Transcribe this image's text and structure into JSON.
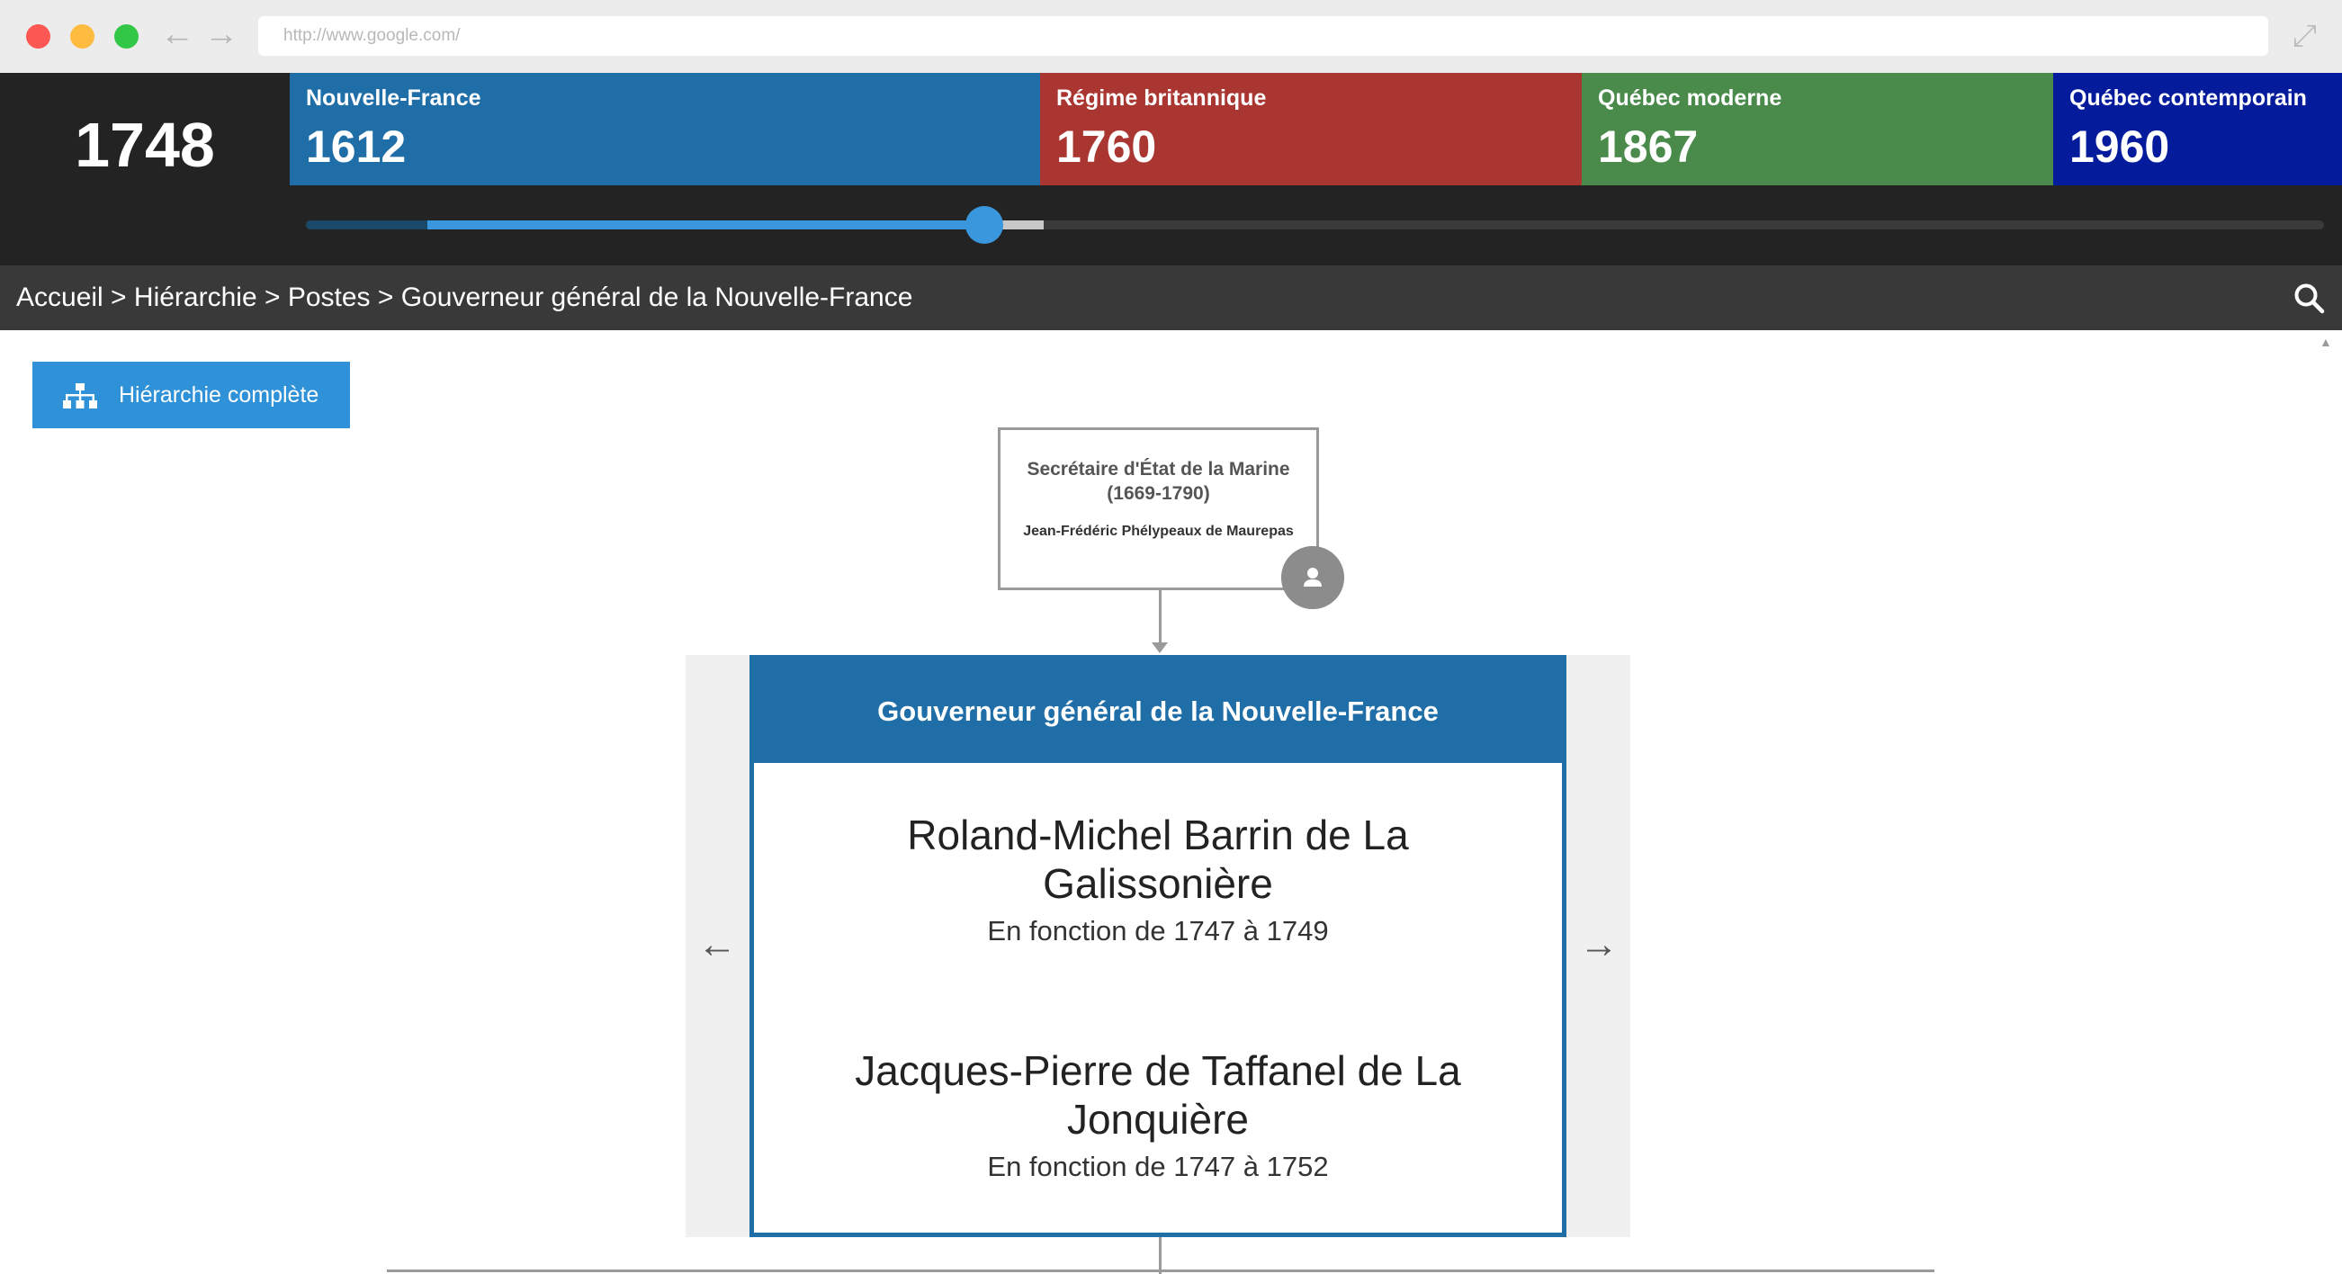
{
  "browser": {
    "url": "http://www.google.com/"
  },
  "timeline": {
    "current_year": "1748",
    "eras": [
      {
        "name": "Nouvelle-France",
        "year": "1612",
        "color": "#1f6ea7"
      },
      {
        "name": "Régime britannique",
        "year": "1760",
        "color": "#a93631"
      },
      {
        "name": "Québec moderne",
        "year": "1867",
        "color": "#4a8b4c"
      },
      {
        "name": "Québec contemporain",
        "year": "1960",
        "color": "#041b9c"
      }
    ],
    "slider_color": "#3a97dd"
  },
  "breadcrumb": {
    "items": [
      "Accueil",
      "Hiérarchie",
      "Postes",
      "Gouverneur général de la Nouvelle-France"
    ],
    "separator": " > "
  },
  "actions": {
    "hierarchy_button": "Hiérarchie complète"
  },
  "parent_post": {
    "title": "Secrétaire d'État de la Marine (1669-1790)",
    "holder": "Jean-Frédéric Phélypeaux de Maurepas"
  },
  "post": {
    "title": "Gouverneur général de la Nouvelle-France",
    "holders": [
      {
        "name": "Roland-Michel Barrin de La Galissonière",
        "term": "En fonction de 1747 à 1749"
      },
      {
        "name": "Jacques-Pierre de Taffanel de La Jonquière",
        "term": "En fonction de 1747 à 1752"
      }
    ]
  },
  "icons": {
    "prev": "arrow-left-icon",
    "next": "arrow-right-icon",
    "search": "search-icon",
    "hierarchy": "org-chart-icon",
    "avatar": "user-icon"
  }
}
